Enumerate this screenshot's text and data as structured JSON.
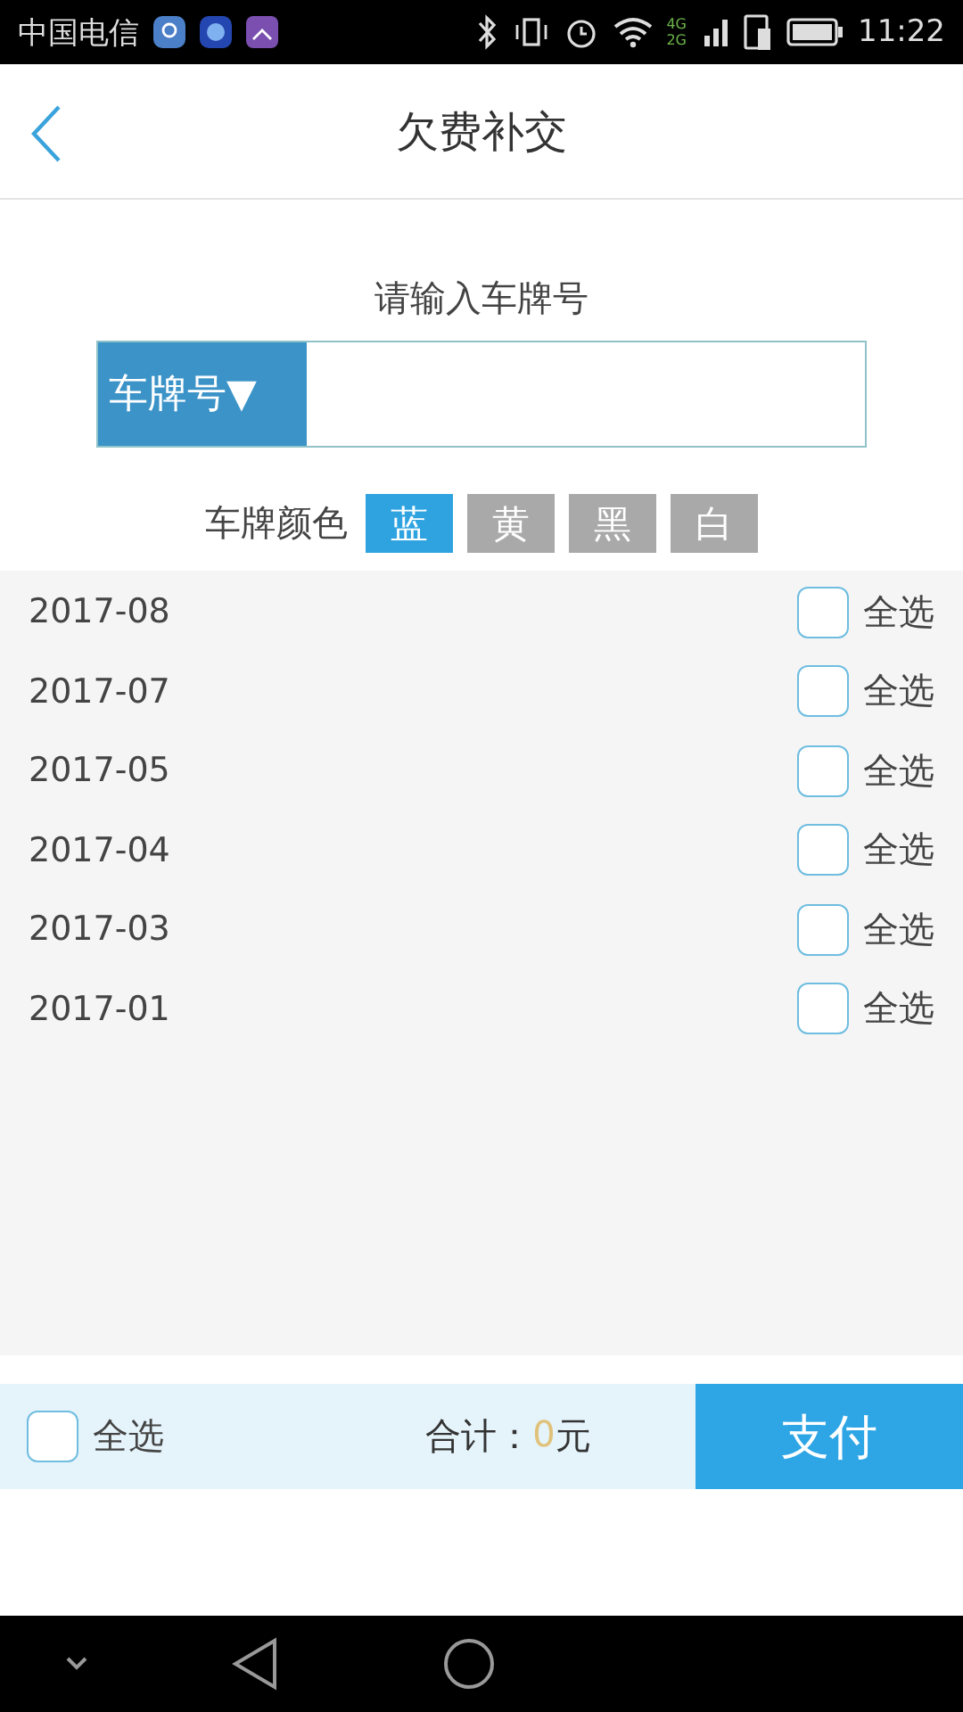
{
  "status_bar": {
    "carrier": "中国电信",
    "network": [
      "4G",
      "2G"
    ],
    "time": "11:22"
  },
  "header": {
    "title": "欠费补交"
  },
  "plate_input": {
    "label": "请输入车牌号",
    "type_button": "车牌号▼"
  },
  "plate_color": {
    "label": "车牌颜色",
    "options": [
      {
        "label": "蓝",
        "selected": true
      },
      {
        "label": "黄",
        "selected": false
      },
      {
        "label": "黑",
        "selected": false
      },
      {
        "label": "白",
        "selected": false
      }
    ]
  },
  "months": [
    {
      "month": "2017-08",
      "select_label": "全选",
      "checked": false
    },
    {
      "month": "2017-07",
      "select_label": "全选",
      "checked": false
    },
    {
      "month": "2017-05",
      "select_label": "全选",
      "checked": false
    },
    {
      "month": "2017-04",
      "select_label": "全选",
      "checked": false
    },
    {
      "month": "2017-03",
      "select_label": "全选",
      "checked": false
    },
    {
      "month": "2017-01",
      "select_label": "全选",
      "checked": false
    }
  ],
  "footer": {
    "select_all": {
      "label": "全选",
      "checked": false
    },
    "total_label": "合计：",
    "amount": "0",
    "unit": "元",
    "pay_button": "支付"
  }
}
